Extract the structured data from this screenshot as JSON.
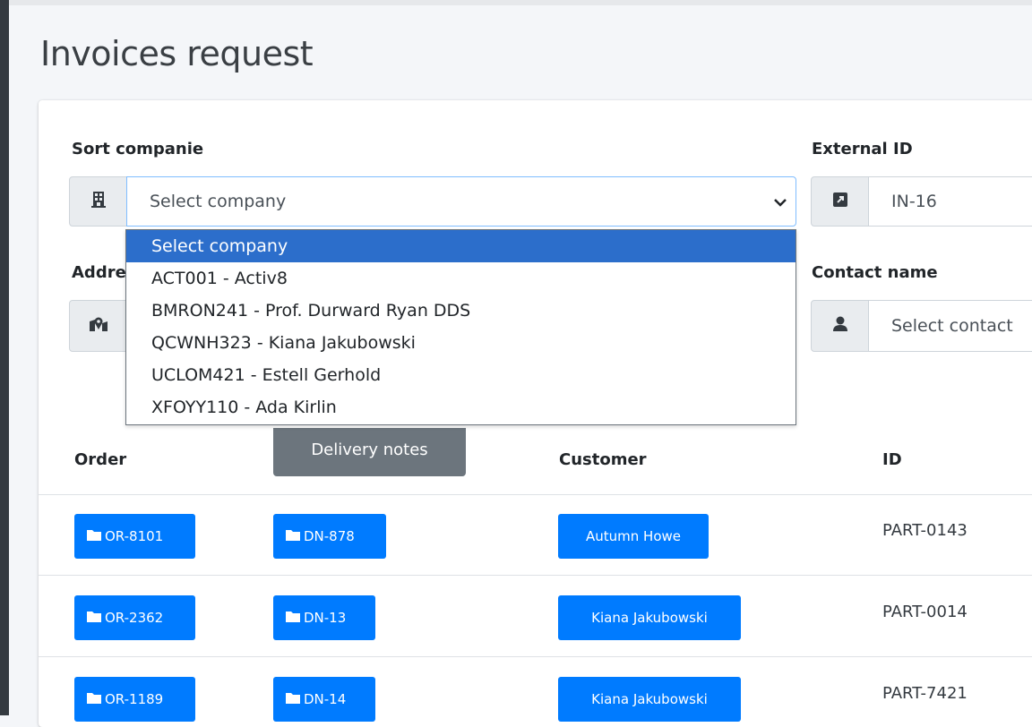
{
  "page": {
    "title": "Invoices request"
  },
  "filters": {
    "company_label": "Sort companie",
    "company_value": "Select company",
    "external_id_label": "External ID",
    "external_id_value": "IN-16",
    "address_label": "Addre",
    "contact_label": "Contact name",
    "contact_value": "Select contact"
  },
  "company_dropdown": {
    "options": [
      "Select company",
      "ACT001 - Activ8",
      "BMRON241 - Prof. Durward Ryan DDS",
      "QCWNH323 - Kiana Jakubowski",
      "UCLOM421 - Estell Gerhold",
      "XFOYY110 - Ada Kirlin"
    ],
    "selected_index": 0
  },
  "tooltip": {
    "text": "Delivery notes"
  },
  "table": {
    "headers": {
      "order": "Order",
      "customer": "Customer",
      "id": "ID"
    },
    "rows": [
      {
        "order": "OR-8101",
        "delivery": "DN-878",
        "customer": "Autumn Howe",
        "id": "PART-0143"
      },
      {
        "order": "OR-2362",
        "delivery": "DN-13",
        "customer": "Kiana Jakubowski",
        "id": "PART-0014"
      },
      {
        "order": "OR-1189",
        "delivery": "DN-14",
        "customer": "Kiana Jakubowski",
        "id": "PART-7421"
      }
    ]
  },
  "colors": {
    "primary": "#007bff",
    "selected_option": "#2c6ecb",
    "sidebar": "#343a40"
  },
  "icons": {
    "company": "building-icon",
    "external_id": "external-link-icon",
    "address": "map-marked-icon",
    "contact": "user-icon",
    "folder": "folder-icon"
  }
}
